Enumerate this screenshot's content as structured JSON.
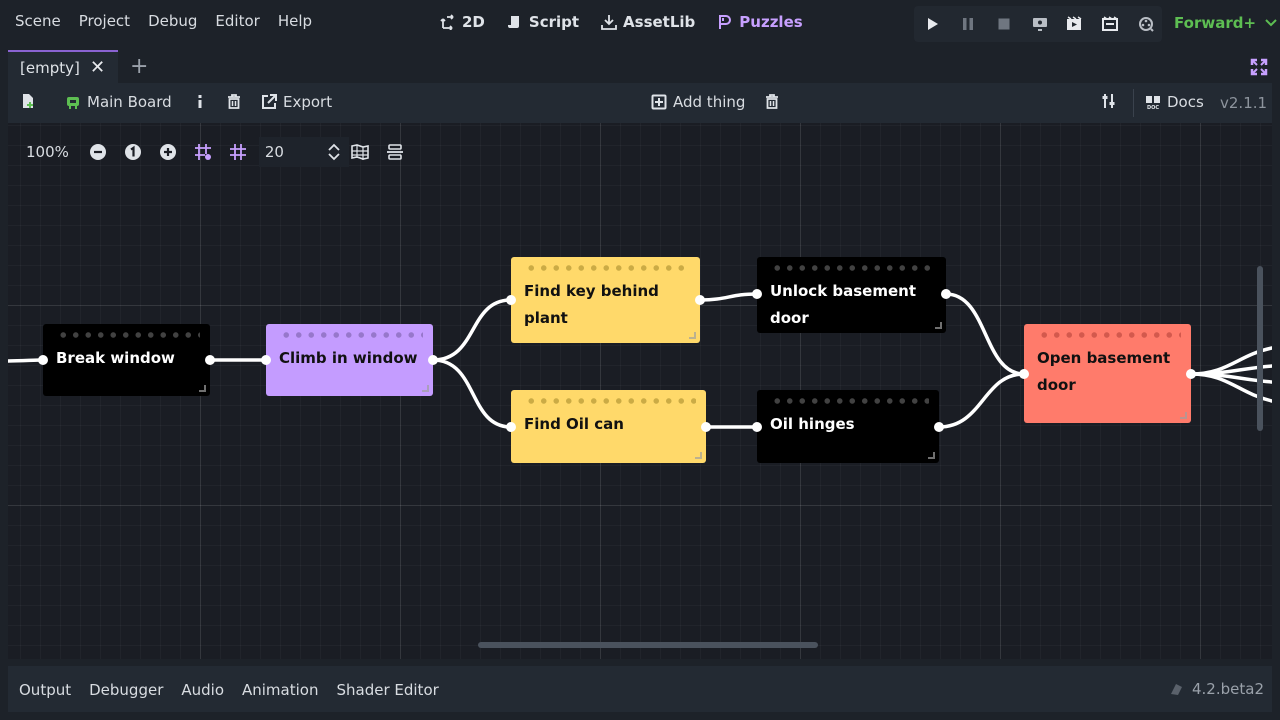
{
  "menu": [
    "Scene",
    "Project",
    "Debug",
    "Editor",
    "Help"
  ],
  "main_screens": [
    {
      "label": "2D",
      "icon": "2d-icon"
    },
    {
      "label": "Script",
      "icon": "script-icon"
    },
    {
      "label": "AssetLib",
      "icon": "assetlib-icon"
    },
    {
      "label": "Puzzles",
      "icon": "puzzles-icon"
    }
  ],
  "renderer": "Forward+",
  "scene_tab": {
    "label": "[empty]"
  },
  "toolbar": {
    "main_board": "Main Board",
    "export": "Export",
    "add_thing": "Add thing",
    "docs": "Docs",
    "version": "v2.1.1"
  },
  "graph_toolbar": {
    "zoom": "100%",
    "snap_value": "20"
  },
  "nodes": [
    {
      "title": "Break window",
      "color": "#000000"
    },
    {
      "title": "Climb in window",
      "color": "#c49cff"
    },
    {
      "title": "Find key behind plant",
      "color": "#ffd96a"
    },
    {
      "title": "Find Oil can",
      "color": "#ffd96a"
    },
    {
      "title": "Unlock basement door",
      "color": "#000000"
    },
    {
      "title": "Oil hinges",
      "color": "#000000"
    },
    {
      "title": "Open basement door",
      "color": "#ff7b6b"
    }
  ],
  "bottom_panel": {
    "tabs": [
      "Output",
      "Debugger",
      "Audio",
      "Animation",
      "Shader Editor"
    ],
    "godot_version": "4.2.beta2"
  },
  "colors": {
    "accent": "#8a63d2",
    "renderer": "#5dbe52",
    "background": "#1d2229"
  }
}
